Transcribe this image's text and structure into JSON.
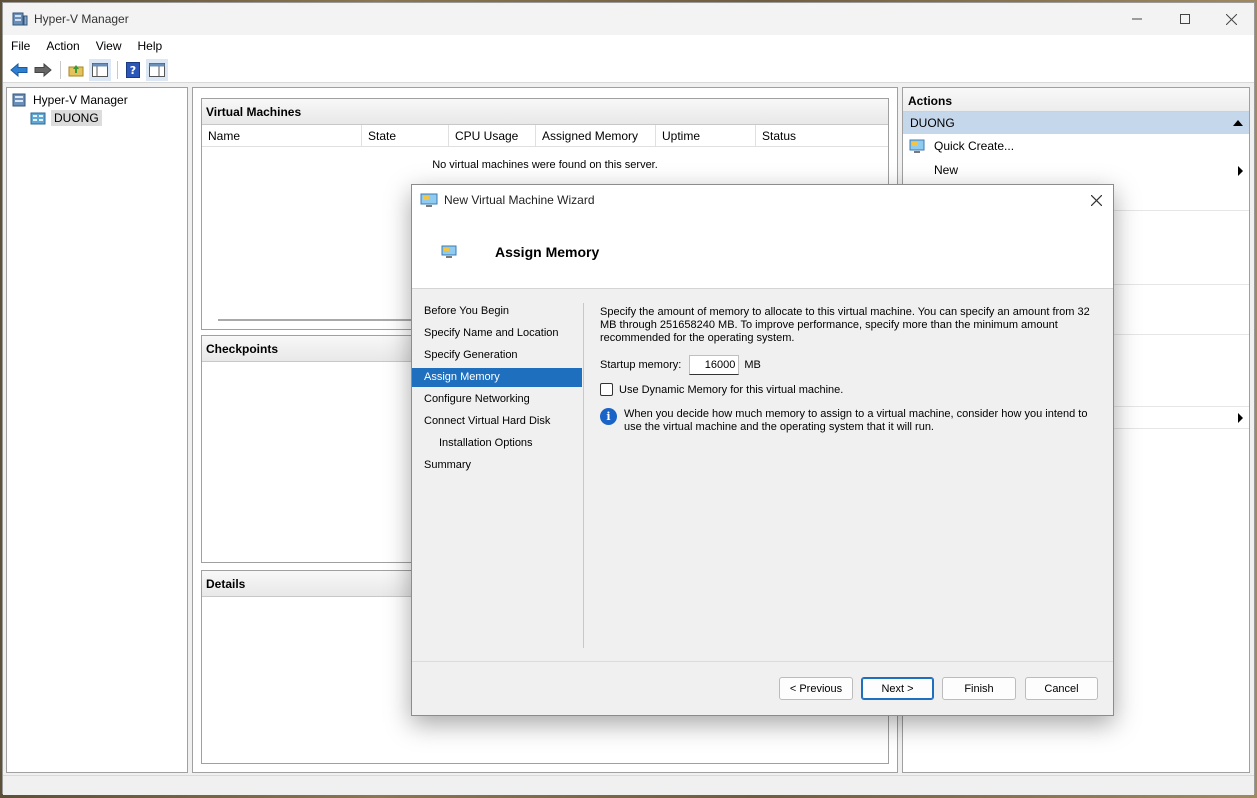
{
  "window": {
    "title": "Hyper-V Manager"
  },
  "menu": [
    "File",
    "Action",
    "View",
    "Help"
  ],
  "tree": {
    "root": "Hyper-V Manager",
    "server": "DUONG"
  },
  "vm_section": {
    "title": "Virtual Machines",
    "columns": [
      "Name",
      "State",
      "CPU Usage",
      "Assigned Memory",
      "Uptime",
      "Status"
    ],
    "empty_message": "No virtual machines were found on this server."
  },
  "checkpoints": {
    "title": "Checkpoints"
  },
  "details": {
    "title": "Details"
  },
  "actions": {
    "title": "Actions",
    "server": "DUONG",
    "items": [
      {
        "label": "Quick Create...",
        "icon": "quick-create-icon"
      },
      {
        "label": "New",
        "icon": "",
        "submenu": true
      }
    ]
  },
  "wizard": {
    "title": "New Virtual Machine Wizard",
    "heading": "Assign Memory",
    "steps": [
      "Before You Begin",
      "Specify Name and Location",
      "Specify Generation",
      "Assign Memory",
      "Configure Networking",
      "Connect Virtual Hard Disk",
      "Installation Options",
      "Summary"
    ],
    "active_step": 3,
    "description": "Specify the amount of memory to allocate to this virtual machine. You can specify an amount from 32 MB through 251658240 MB. To improve performance, specify more than the minimum amount recommended for the operating system.",
    "startup_label": "Startup memory:",
    "startup_value": "16000",
    "unit": "MB",
    "dynamic_label": "Use Dynamic Memory for this virtual machine.",
    "dynamic_checked": false,
    "info": "When you decide how much memory to assign to a virtual machine, consider how you intend to use the virtual machine and the operating system that it will run.",
    "buttons": {
      "previous": "< Previous",
      "next": "Next >",
      "finish": "Finish",
      "cancel": "Cancel"
    }
  },
  "colors": {
    "accent": "#1f6fbf",
    "actions_band": "#c5d7ea",
    "info": "#1a63c7"
  }
}
